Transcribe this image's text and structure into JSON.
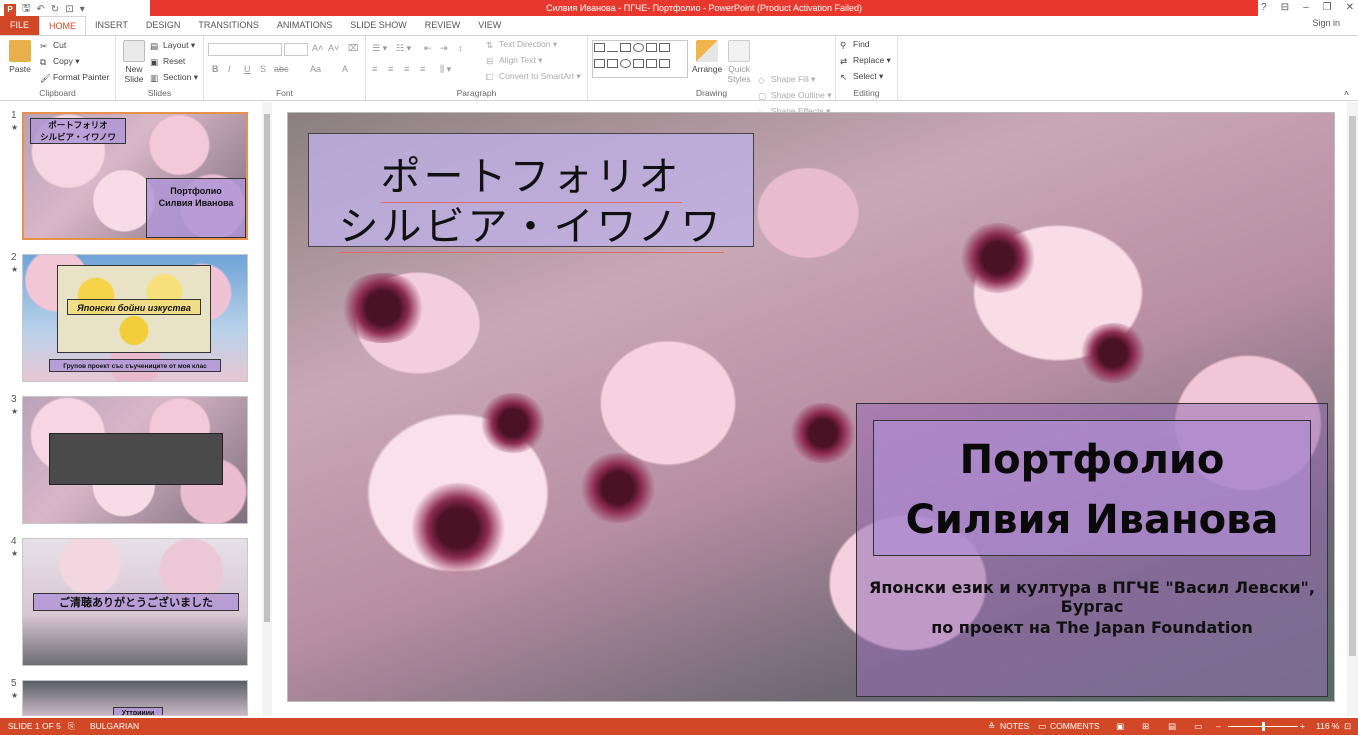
{
  "window": {
    "title": "Силвия Иванова - ПГЧЕ- Портфолио -  PowerPoint (Product Activation Failed)",
    "help": "?",
    "sign_in": "Sign in"
  },
  "tabs": [
    "FILE",
    "HOME",
    "INSERT",
    "DESIGN",
    "TRANSITIONS",
    "ANIMATIONS",
    "SLIDE SHOW",
    "REVIEW",
    "VIEW"
  ],
  "ribbon": {
    "clipboard": {
      "label": "Clipboard",
      "paste": "Paste",
      "cut": "Cut",
      "copy": "Copy",
      "format_painter": "Format Painter"
    },
    "slides": {
      "label": "Slides",
      "new_slide": "New Slide",
      "layout": "Layout",
      "reset": "Reset",
      "section": "Section"
    },
    "font": {
      "label": "Font",
      "bold": "B",
      "italic": "I",
      "underline": "U",
      "strike": "S",
      "spacing": "abc",
      "case": "Aa",
      "color": "A"
    },
    "paragraph": {
      "label": "Paragraph",
      "text_direction": "Text Direction",
      "align_text": "Align Text",
      "convert": "Convert to SmartArt"
    },
    "drawing": {
      "label": "Drawing",
      "arrange": "Arrange",
      "quick_styles": "Quick Styles",
      "shape_fill": "Shape Fill",
      "shape_outline": "Shape Outline",
      "shape_effects": "Shape Effects"
    },
    "editing": {
      "label": "Editing",
      "find": "Find",
      "replace": "Replace",
      "select": "Select"
    }
  },
  "thumbnails": [
    {
      "num": "1",
      "star": "★",
      "text1": "ポートフォリオ",
      "text2": "シルビア・イワノワ",
      "text3": "Портфолио",
      "text4": "Силвия Иванова"
    },
    {
      "num": "2",
      "star": "★",
      "text1": "Японски бойни изкуства",
      "text2": "Групов проект със съучениците от моя клас"
    },
    {
      "num": "3",
      "star": "★"
    },
    {
      "num": "4",
      "star": "★",
      "text1": "ご清聴ありがとうございました"
    },
    {
      "num": "5",
      "star": "★",
      "text1": "Уттрииии"
    }
  ],
  "slide": {
    "jp_line1": "ポートフォリオ",
    "jp_line2": "シルビア・イワノワ",
    "title_line1": "Портфолио",
    "title_line2": "Силвия Иванова",
    "sub_line1": "Японски език и култура в ПГЧЕ \"Васил Левски\", Бургас",
    "sub_line2": "по проект на The Japan Foundation"
  },
  "status": {
    "slide_of": "SLIDE 1 OF 5",
    "language": "BULGARIAN",
    "notes": "NOTES",
    "comments": "COMMENTS",
    "zoom": "116 %"
  },
  "colors": {
    "accent": "#d24726",
    "title_bar": "#e8382d"
  }
}
